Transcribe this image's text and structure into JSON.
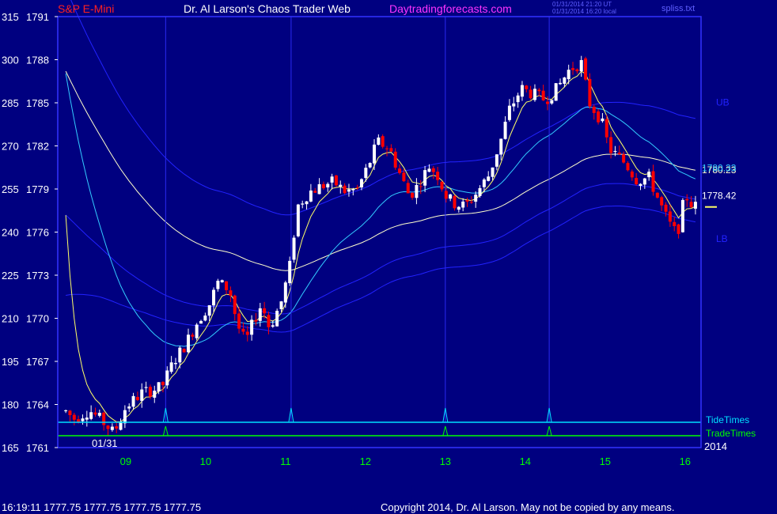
{
  "header": {
    "symbol": "S&P E-Mini",
    "author": "Dr. Al Larson's Chaos Trader Web",
    "site": "Daytradingforecasts.com",
    "stamp_utc": "01/31/2014 21:20 UT",
    "stamp_local": "01/31/2014 16:20 local",
    "file": "spliss.txt"
  },
  "footer": {
    "quote": "16:19:11  1777.75  1777.75  1777.75  1777.75",
    "copyright": "Copyright 2014, Dr. Al Larson. May not be copied by any means."
  },
  "colors": {
    "background": "#000080",
    "frame": "#3333ff",
    "up_bar": "#ffffff",
    "down_bar": "#ff0000",
    "ema_fast": "#ffff66",
    "ema_mid": "#33ccff",
    "ema_slow": "#ffffcc",
    "band": "#2222ff",
    "tide_times": "#00e0ff",
    "trade_times": "#00ff00",
    "symbol_text": "#ff2020",
    "site_text": "#ff33ff",
    "axis_text": "#ffffff",
    "hour_text": "#00ff00"
  },
  "chart_data": {
    "type": "candlestick",
    "ylim": [
      1761,
      1791
    ],
    "y_ticks": [
      {
        "left": "315",
        "price": "1791",
        "value": 1791
      },
      {
        "left": "300",
        "price": "1788",
        "value": 1788
      },
      {
        "left": "285",
        "price": "1785",
        "value": 1785
      },
      {
        "left": "270",
        "price": "1782",
        "value": 1782
      },
      {
        "left": "255",
        "price": "1779",
        "value": 1779
      },
      {
        "left": "240",
        "price": "1776",
        "value": 1776
      },
      {
        "left": "225",
        "price": "1773",
        "value": 1773
      },
      {
        "left": "210",
        "price": "1770",
        "value": 1770
      },
      {
        "left": "195",
        "price": "1767",
        "value": 1767
      },
      {
        "left": "180",
        "price": "1764",
        "value": 1764
      },
      {
        "left": "165",
        "price": "1761",
        "value": 1761
      }
    ],
    "x_range": [
      8.15,
      16.2
    ],
    "x_ticks": [
      {
        "label": "09",
        "value": 9.0
      },
      {
        "label": "10",
        "value": 10.0
      },
      {
        "label": "11",
        "value": 11.0
      },
      {
        "label": "12",
        "value": 12.0
      },
      {
        "label": "13",
        "value": 13.0
      },
      {
        "label": "14",
        "value": 14.0
      },
      {
        "label": "15",
        "value": 15.0
      },
      {
        "label": "16",
        "value": 16.0
      }
    ],
    "date_label": "01/31",
    "year_label": "2014",
    "timing_lines": [
      "TideTimes",
      "TradeTimes"
    ],
    "tide_times": [
      9.5,
      11.07,
      13.0,
      14.3
    ],
    "trade_times": [
      9.5,
      13.0,
      14.3
    ],
    "band_labels": {
      "upper": "UB",
      "lower": "LB"
    },
    "value_labels": {
      "ema_slow": "1780.23",
      "ema_mid": "1780.33",
      "ema_fast": "1778.42"
    },
    "last_price": 1777.75,
    "price_path": [
      [
        8.2,
        1763.8
      ],
      [
        8.35,
        1763.0
      ],
      [
        8.55,
        1763.6
      ],
      [
        8.75,
        1762.6
      ],
      [
        8.85,
        1762.0
      ],
      [
        9.0,
        1763.8
      ],
      [
        9.2,
        1764.8
      ],
      [
        9.45,
        1765.2
      ],
      [
        9.6,
        1767.0
      ],
      [
        9.75,
        1768.2
      ],
      [
        9.9,
        1769.8
      ],
      [
        10.05,
        1771.0
      ],
      [
        10.15,
        1772.5
      ],
      [
        10.3,
        1772.0
      ],
      [
        10.4,
        1769.5
      ],
      [
        10.5,
        1768.3
      ],
      [
        10.6,
        1769.8
      ],
      [
        10.7,
        1771.0
      ],
      [
        10.8,
        1769.3
      ],
      [
        10.95,
        1771.2
      ],
      [
        11.05,
        1773.5
      ],
      [
        11.15,
        1777.8
      ],
      [
        11.3,
        1778.8
      ],
      [
        11.45,
        1779.2
      ],
      [
        11.6,
        1779.5
      ],
      [
        11.75,
        1778.8
      ],
      [
        11.9,
        1779.0
      ],
      [
        12.05,
        1780.8
      ],
      [
        12.15,
        1782.3
      ],
      [
        12.3,
        1781.8
      ],
      [
        12.45,
        1779.8
      ],
      [
        12.55,
        1778.5
      ],
      [
        12.65,
        1779.2
      ],
      [
        12.8,
        1780.6
      ],
      [
        12.9,
        1780.0
      ],
      [
        13.0,
        1778.6
      ],
      [
        13.1,
        1778.0
      ],
      [
        13.25,
        1777.8
      ],
      [
        13.4,
        1778.8
      ],
      [
        13.55,
        1780.0
      ],
      [
        13.7,
        1782.5
      ],
      [
        13.8,
        1784.5
      ],
      [
        13.95,
        1786.0
      ],
      [
        14.1,
        1785.6
      ],
      [
        14.25,
        1785.2
      ],
      [
        14.4,
        1786.0
      ],
      [
        14.55,
        1787.3
      ],
      [
        14.7,
        1787.8
      ],
      [
        14.8,
        1785.0
      ],
      [
        14.95,
        1783.8
      ],
      [
        15.05,
        1781.8
      ],
      [
        15.25,
        1780.8
      ],
      [
        15.4,
        1779.6
      ],
      [
        15.55,
        1779.8
      ],
      [
        15.7,
        1777.8
      ],
      [
        15.8,
        1776.6
      ],
      [
        15.9,
        1775.8
      ],
      [
        16.0,
        1778.6
      ],
      [
        16.1,
        1777.8
      ]
    ]
  }
}
